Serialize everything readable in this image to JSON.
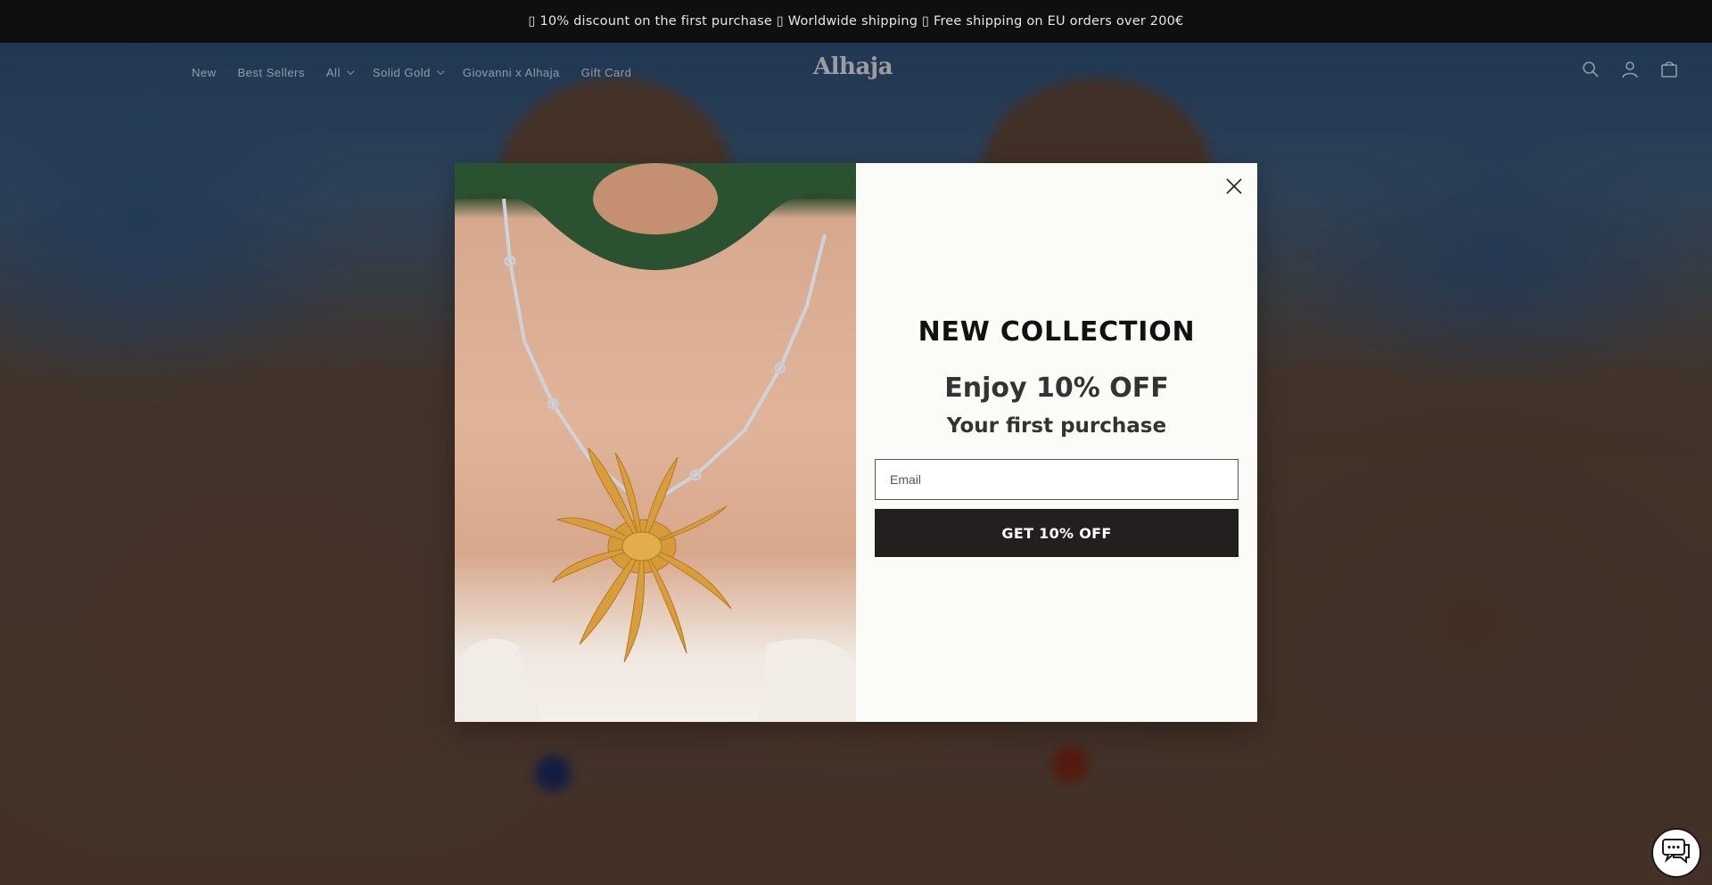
{
  "announcement": {
    "text": "▯ 10% discount on the first purchase ▯ Worldwide shipping ▯ Free shipping on EU orders over 200€"
  },
  "header": {
    "nav": [
      {
        "label": "New",
        "has_dropdown": false
      },
      {
        "label": "Best Sellers",
        "has_dropdown": false
      },
      {
        "label": "All",
        "has_dropdown": true
      },
      {
        "label": "Solid Gold",
        "has_dropdown": true
      },
      {
        "label": "Giovanni x Alhaja",
        "has_dropdown": false
      },
      {
        "label": "Gift Card",
        "has_dropdown": false
      }
    ],
    "logo": "Alhaja",
    "icons": [
      "search-icon",
      "account-icon",
      "cart-icon"
    ]
  },
  "popup": {
    "headline": "NEW COLLECTION",
    "offer": "Enjoy 10% OFF",
    "subtext": "Your first purchase",
    "email_placeholder": "Email",
    "cta_label": "GET 10% OFF",
    "close_icon": "close-icon"
  },
  "chat": {
    "icon": "chat-icon"
  },
  "colors": {
    "announcement_bg": "#0f0f0f",
    "popup_bg": "#fbfbf7",
    "cta_bg": "#231f1e",
    "cta_text": "#ffffff"
  }
}
